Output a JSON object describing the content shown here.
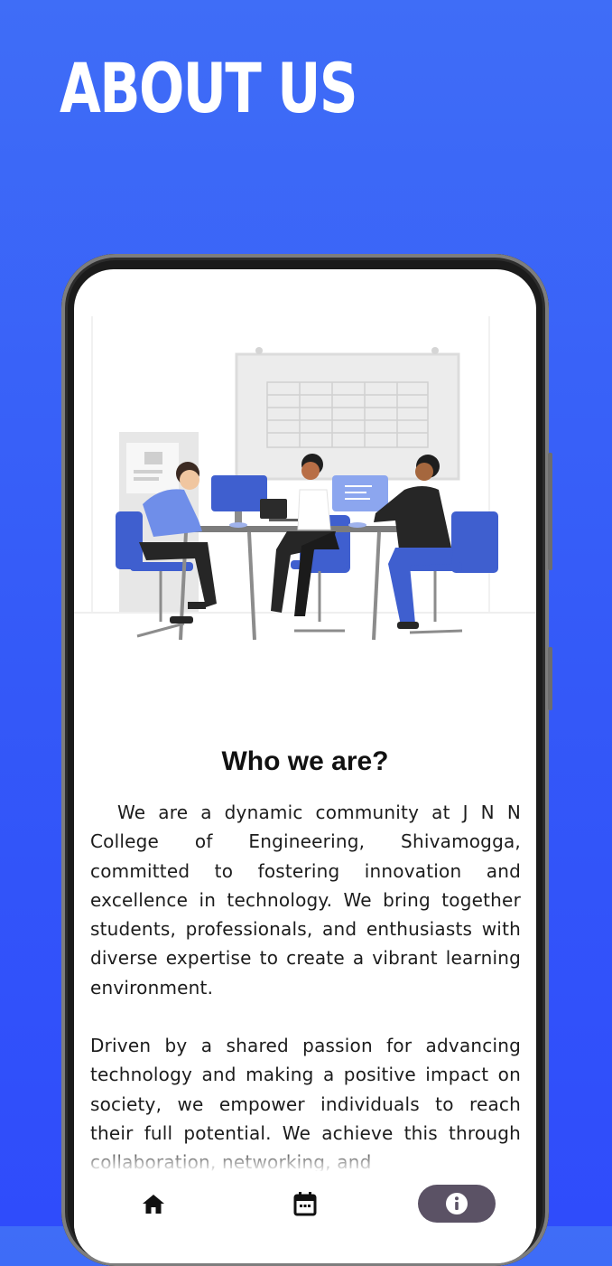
{
  "header": {
    "title": "ABOUT US"
  },
  "content": {
    "heading": "Who we are?",
    "paragraphs": [
      "We are a dynamic community at J N N College of Engineering, Shivamogga, committed to fostering innovation and excellence in technology. We bring together students, professionals, and enthusiasts with diverse expertise to create a vibrant learning environment.",
      "Driven by a shared passion for advancing technology and making a positive impact on society, we empower individuals to reach their full potential. We achieve this through collaboration, networking, and"
    ]
  },
  "bottom_nav": {
    "items": [
      {
        "icon": "home-icon",
        "active": false
      },
      {
        "icon": "calendar-icon",
        "active": false
      },
      {
        "icon": "info-icon",
        "active": true
      }
    ],
    "active_color": "#5b5265"
  },
  "colors": {
    "background": "#3459f8",
    "accent": "#3f5fcf",
    "title": "#ffffff"
  }
}
